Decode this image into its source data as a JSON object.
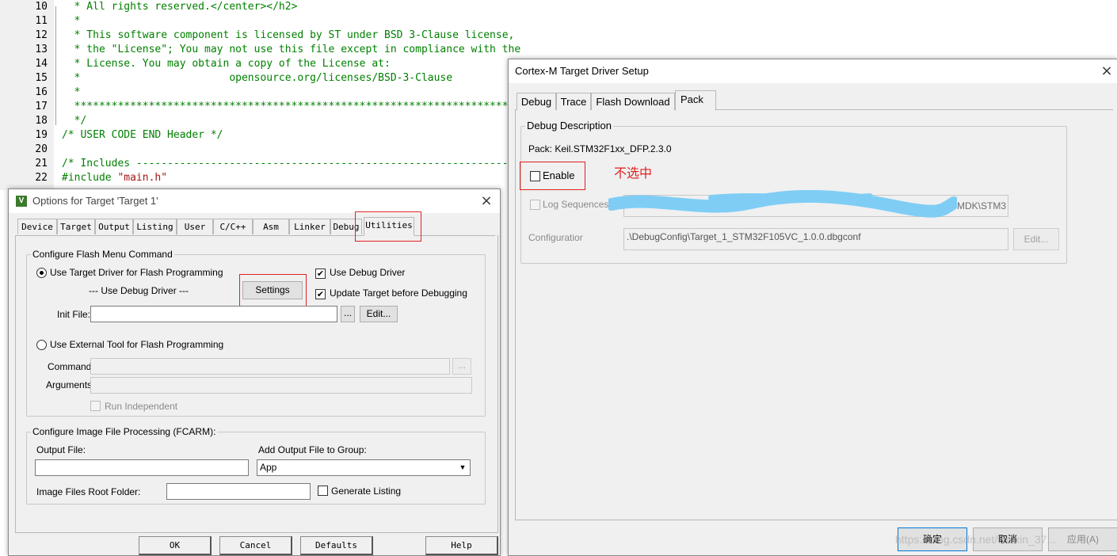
{
  "editor": {
    "lines": [
      {
        "num": "10",
        "text": "  * All rights reserved.</center></h2>"
      },
      {
        "num": "11",
        "text": "  *"
      },
      {
        "num": "12",
        "text": "  * This software component is licensed by ST under BSD 3-Clause license,"
      },
      {
        "num": "13",
        "text": "  * the \"License\"; You may not use this file except in compliance with the"
      },
      {
        "num": "14",
        "text": "  * License. You may obtain a copy of the License at:"
      },
      {
        "num": "15",
        "text": "  *                        opensource.org/licenses/BSD-3-Clause"
      },
      {
        "num": "16",
        "text": "  *"
      },
      {
        "num": "17",
        "text": "  ******************************************************************************"
      },
      {
        "num": "18",
        "text": "  */"
      },
      {
        "num": "19",
        "text": "/* USER CODE END Header */"
      },
      {
        "num": "20",
        "text": ""
      },
      {
        "num": "21",
        "text": "/* Includes ------------------------------------------------------------------"
      },
      {
        "num": "22",
        "text": "#include \"main.h\""
      }
    ]
  },
  "options_dialog": {
    "title": "Options for Target 'Target 1'",
    "close_glyph": "×",
    "tabs": [
      "Device",
      "Target",
      "Output",
      "Listing",
      "User",
      "C/C++",
      "Asm",
      "Linker",
      "Debug",
      "Utilities"
    ],
    "flash_group": {
      "legend": "Configure Flash Menu Command",
      "use_target_driver": "Use Target Driver for Flash Programming",
      "driver_display": "--- Use Debug Driver ---",
      "settings_button": "Settings",
      "use_debug_driver": "Use Debug Driver",
      "update_target": "Update Target before Debugging",
      "init_file_label": "Init File:",
      "init_file_value": "",
      "browse_button": "...",
      "edit_button": "Edit...",
      "use_external_tool": "Use External Tool for Flash Programming",
      "command_label": "Command:",
      "arguments_label": "Arguments:",
      "run_independent": "Run Independent"
    },
    "image_group": {
      "legend": "Configure Image File Processing (FCARM):",
      "output_file_label": "Output File:",
      "output_file_value": "",
      "add_output_label": "Add Output File  to Group:",
      "group_value": "App",
      "root_folder_label": "Image Files Root Folder:",
      "root_folder_value": "",
      "generate_listing": "Generate Listing"
    },
    "buttons": {
      "ok": "OK",
      "cancel": "Cancel",
      "defaults": "Defaults",
      "help": "Help"
    },
    "checked_glyph": "✔"
  },
  "driver_dialog": {
    "title": "Cortex-M Target Driver Setup",
    "close_glyph": "×",
    "tabs": [
      "Debug",
      "Trace",
      "Flash Download",
      "Pack"
    ],
    "group_legend": "Debug Description",
    "pack_label": "Pack:  Keil.STM32F1xx_DFP.2.3.0",
    "enable_label": "Enable",
    "annotation": "不选中",
    "log_sequences_label": "Log Sequences:",
    "log_sequences_value_tail": "MDK\\STM3",
    "configuration_label": "Configuratior",
    "configuration_value": ".\\DebugConfig\\Target_1_STM32F105VC_1.0.0.dbgconf",
    "edit_button": "Edit...",
    "buttons": {
      "ok": "确定",
      "cancel": "取消",
      "apply": "应用(A)"
    },
    "watermark": "https://blog.csdn.net/weixin_37..."
  },
  "colors": {
    "highlight_red": "#e02020",
    "comment_green": "#008000",
    "string_red": "#a31515",
    "preprocessor_purple": "#800080",
    "scribble_blue": "#7fcdf5"
  }
}
